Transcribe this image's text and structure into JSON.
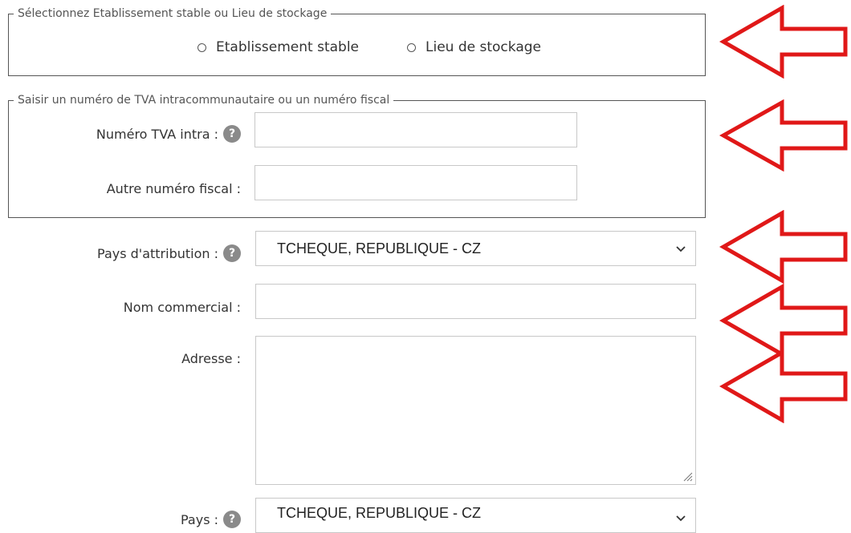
{
  "section1": {
    "legend": "Sélectionnez Etablissement stable ou Lieu de stockage",
    "options": [
      "Etablissement stable",
      "Lieu de stockage"
    ]
  },
  "section2": {
    "legend": "Saisir un numéro de TVA intracommunautaire ou un numéro fiscal",
    "tva_label": "Numéro TVA intra :",
    "tva_value": "",
    "autre_label": "Autre numéro fiscal :",
    "autre_value": ""
  },
  "fields": {
    "help_glyph": "?",
    "pays_attribution_label": "Pays d'attribution :",
    "pays_attribution_value": "TCHEQUE, REPUBLIQUE - CZ",
    "nom_commercial_label": "Nom commercial :",
    "nom_commercial_value": "",
    "adresse_label": "Adresse :",
    "adresse_value": "",
    "pays_label": "Pays :",
    "pays_value": "TCHEQUE, REPUBLIQUE - CZ"
  },
  "icons": {
    "chevron": "chevron-down-icon",
    "help": "help-icon",
    "arrow": "red-arrow-left-icon"
  },
  "colors": {
    "arrow": "#e01818",
    "help": "#8a8a8a",
    "border": "#c8c8c8"
  }
}
